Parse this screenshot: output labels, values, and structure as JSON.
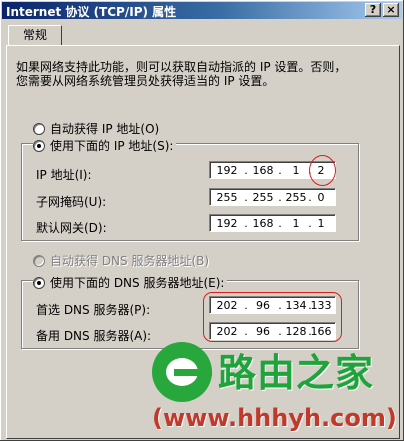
{
  "window": {
    "title": "Internet 协议 (TCP/IP) 属性"
  },
  "titlebar": {
    "help_label": "?",
    "close_label": "×"
  },
  "tabs": [
    {
      "label": "常规"
    }
  ],
  "intro": {
    "line1": "如果网络支持此功能，则可以获取自动指派的 IP 设置。否则，",
    "line2": "您需要从网络系统管理员处获得适当的 IP 设置。"
  },
  "ip_mode": {
    "auto_label": "自动获得 IP 地址(O)",
    "manual_label": "使用下面的 IP 地址(S):",
    "selected": "manual"
  },
  "ip_fields": {
    "ip_address": {
      "label": "IP 地址(I):",
      "octets": [
        "192",
        "168",
        "1",
        "2"
      ]
    },
    "subnet_mask": {
      "label": "子网掩码(U):",
      "octets": [
        "255",
        "255",
        "255",
        "0"
      ]
    },
    "gateway": {
      "label": "默认网关(D):",
      "octets": [
        "192",
        "168",
        "1",
        "1"
      ]
    }
  },
  "dns_mode": {
    "auto_label": "自动获得 DNS 服务器地址(B)",
    "manual_label": "使用下面的 DNS 服务器地址(E):",
    "selected": "manual"
  },
  "dns_fields": {
    "preferred": {
      "label": "首选 DNS 服务器(P):",
      "octets": [
        "202",
        "96",
        "134",
        "133"
      ]
    },
    "alternate": {
      "label": "备用 DNS 服务器(A):",
      "octets": [
        "202",
        "96",
        "128",
        "166"
      ]
    }
  },
  "annotation_color": "#d42020",
  "watermark": {
    "brand": "路由之家",
    "url": "(www.hhhyh.com)"
  }
}
